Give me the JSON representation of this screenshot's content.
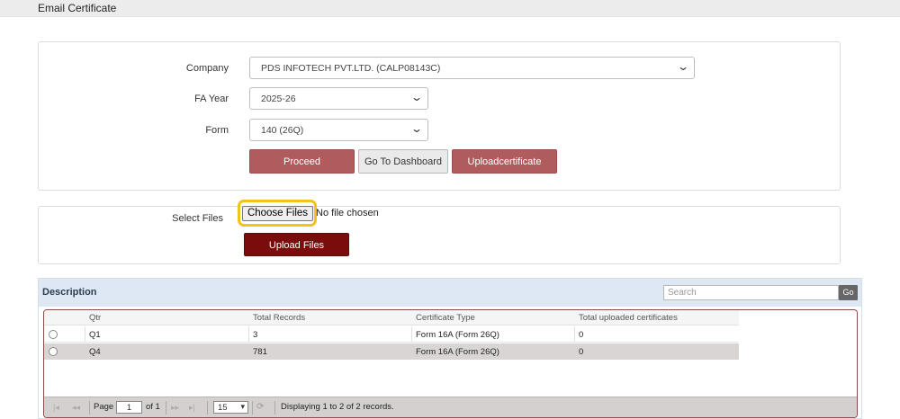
{
  "page": {
    "title": "Email Certificate"
  },
  "form": {
    "company_label": "Company",
    "company_value": "PDS INFOTECH PVT.LTD. (CALP08143C)",
    "fa_year_label": "FA Year",
    "fa_year_value": "2025-26",
    "form_label": "Form",
    "form_value": "140 (26Q)",
    "proceed_label": "Proceed",
    "dashboard_label": "Go To Dashboard",
    "upload_cert_label": "Uploadcertificate"
  },
  "upload": {
    "select_files_label": "Select Files",
    "choose_files_label": "Choose Files",
    "no_file_text": "No file chosen",
    "upload_files_label": "Upload Files"
  },
  "grid": {
    "caption": "Description",
    "search_placeholder": "Search",
    "go_label": "Go",
    "columns": [
      "Qtr",
      "Total Records",
      "Certificate Type",
      "Total uploaded certificates"
    ],
    "rows": [
      {
        "qtr": "Q1",
        "total_records": "3",
        "certificate_type": "Form 16A (Form 26Q)",
        "uploaded": "0"
      },
      {
        "qtr": "Q4",
        "total_records": "781",
        "certificate_type": "Form 16A (Form 26Q)",
        "uploaded": "0"
      }
    ],
    "pager": {
      "page_label": "Page",
      "page_value": "1",
      "of_label": "of 1",
      "page_size": "15",
      "status_text": "Displaying 1 to 2 of 2 records."
    }
  },
  "colors": {
    "accent_red": "#b05c5c",
    "dark_red": "#7b0c0c",
    "highlight": "#f2c418"
  },
  "icons": [
    "chevron-down-icon",
    "first-page-icon",
    "prev-page-icon",
    "next-page-icon",
    "last-page-icon",
    "refresh-icon"
  ]
}
